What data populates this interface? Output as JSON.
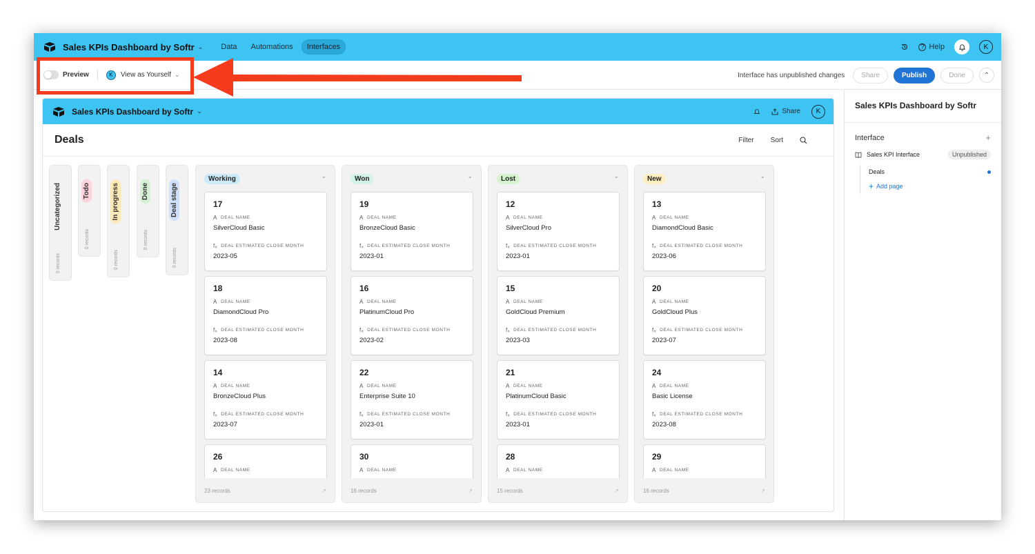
{
  "app": {
    "title": "Sales KPIs Dashboard by Softr",
    "nav": [
      {
        "label": "Data",
        "active": false
      },
      {
        "label": "Automations",
        "active": false
      },
      {
        "label": "Interfaces",
        "active": true
      }
    ],
    "help_label": "Help",
    "avatar_initial": "K",
    "brand_color": "#3dc4f3"
  },
  "toolbar": {
    "preview_label": "Preview",
    "view_as_initial": "K",
    "view_as_label": "View as Yourself",
    "status_text": "Interface has unpublished changes",
    "share_label": "Share",
    "publish_label": "Publish",
    "done_label": "Done"
  },
  "interface": {
    "title": "Sales KPIs Dashboard by Softr",
    "share_label": "Share",
    "avatar_initial": "K",
    "page_title": "Deals",
    "filter_label": "Filter",
    "sort_label": "Sort"
  },
  "collapsed_columns": [
    {
      "label": "Uncategorized",
      "count": "0 records",
      "color": "#f2f2f2"
    },
    {
      "label": "Todo",
      "count": "0 records",
      "color": "#fbd3dd"
    },
    {
      "label": "In progress",
      "count": "0 records",
      "color": "#fde9b8"
    },
    {
      "label": "Done",
      "count": "0 records",
      "color": "#d4f1d3"
    },
    {
      "label": "Deal stage",
      "count": "0 records",
      "color": "#cfe0fb"
    }
  ],
  "columns": [
    {
      "label": "Working",
      "color": "#cdeaf9",
      "footer": "23 records",
      "cards": [
        {
          "id": "17",
          "deal_name": "SilverCloud Basic",
          "month": "2023-05"
        },
        {
          "id": "18",
          "deal_name": "DiamondCloud Pro",
          "month": "2023-08"
        },
        {
          "id": "14",
          "deal_name": "BronzeCloud Plus",
          "month": "2023-07"
        },
        {
          "id": "26",
          "deal_name": "",
          "month": ""
        }
      ]
    },
    {
      "label": "Won",
      "color": "#d2f2ea",
      "footer": "16 records",
      "cards": [
        {
          "id": "19",
          "deal_name": "BronzeCloud Basic",
          "month": "2023-01"
        },
        {
          "id": "16",
          "deal_name": "PlatinumCloud Pro",
          "month": "2023-02"
        },
        {
          "id": "22",
          "deal_name": "Enterprise Suite 10",
          "month": "2023-01"
        },
        {
          "id": "30",
          "deal_name": "",
          "month": ""
        }
      ]
    },
    {
      "label": "Lost",
      "color": "#d6f3cf",
      "footer": "15 records",
      "cards": [
        {
          "id": "12",
          "deal_name": "SilverCloud Pro",
          "month": "2023-01"
        },
        {
          "id": "15",
          "deal_name": "GoldCloud Premium",
          "month": "2023-03"
        },
        {
          "id": "21",
          "deal_name": "PlatinumCloud Basic",
          "month": "2023-01"
        },
        {
          "id": "28",
          "deal_name": "",
          "month": ""
        }
      ]
    },
    {
      "label": "New",
      "color": "#fdeec2",
      "footer": "16 records",
      "cards": [
        {
          "id": "13",
          "deal_name": "DiamondCloud Basic",
          "month": "2023-06"
        },
        {
          "id": "20",
          "deal_name": "GoldCloud Plus",
          "month": "2023-07"
        },
        {
          "id": "24",
          "deal_name": "Basic License",
          "month": "2023-08"
        },
        {
          "id": "29",
          "deal_name": "",
          "month": ""
        }
      ]
    }
  ],
  "field_labels": {
    "deal_name": "DEAL NAME",
    "month": "DEAL ESTIMATED CLOSE MONTH"
  },
  "sidebar": {
    "title": "Sales KPIs Dashboard by Softr",
    "section_title": "Interface",
    "interface_name": "Sales KPI Interface",
    "interface_status": "Unpublished",
    "page_name": "Deals",
    "add_page_label": "Add page"
  },
  "annotation_color": "#f43b1c"
}
